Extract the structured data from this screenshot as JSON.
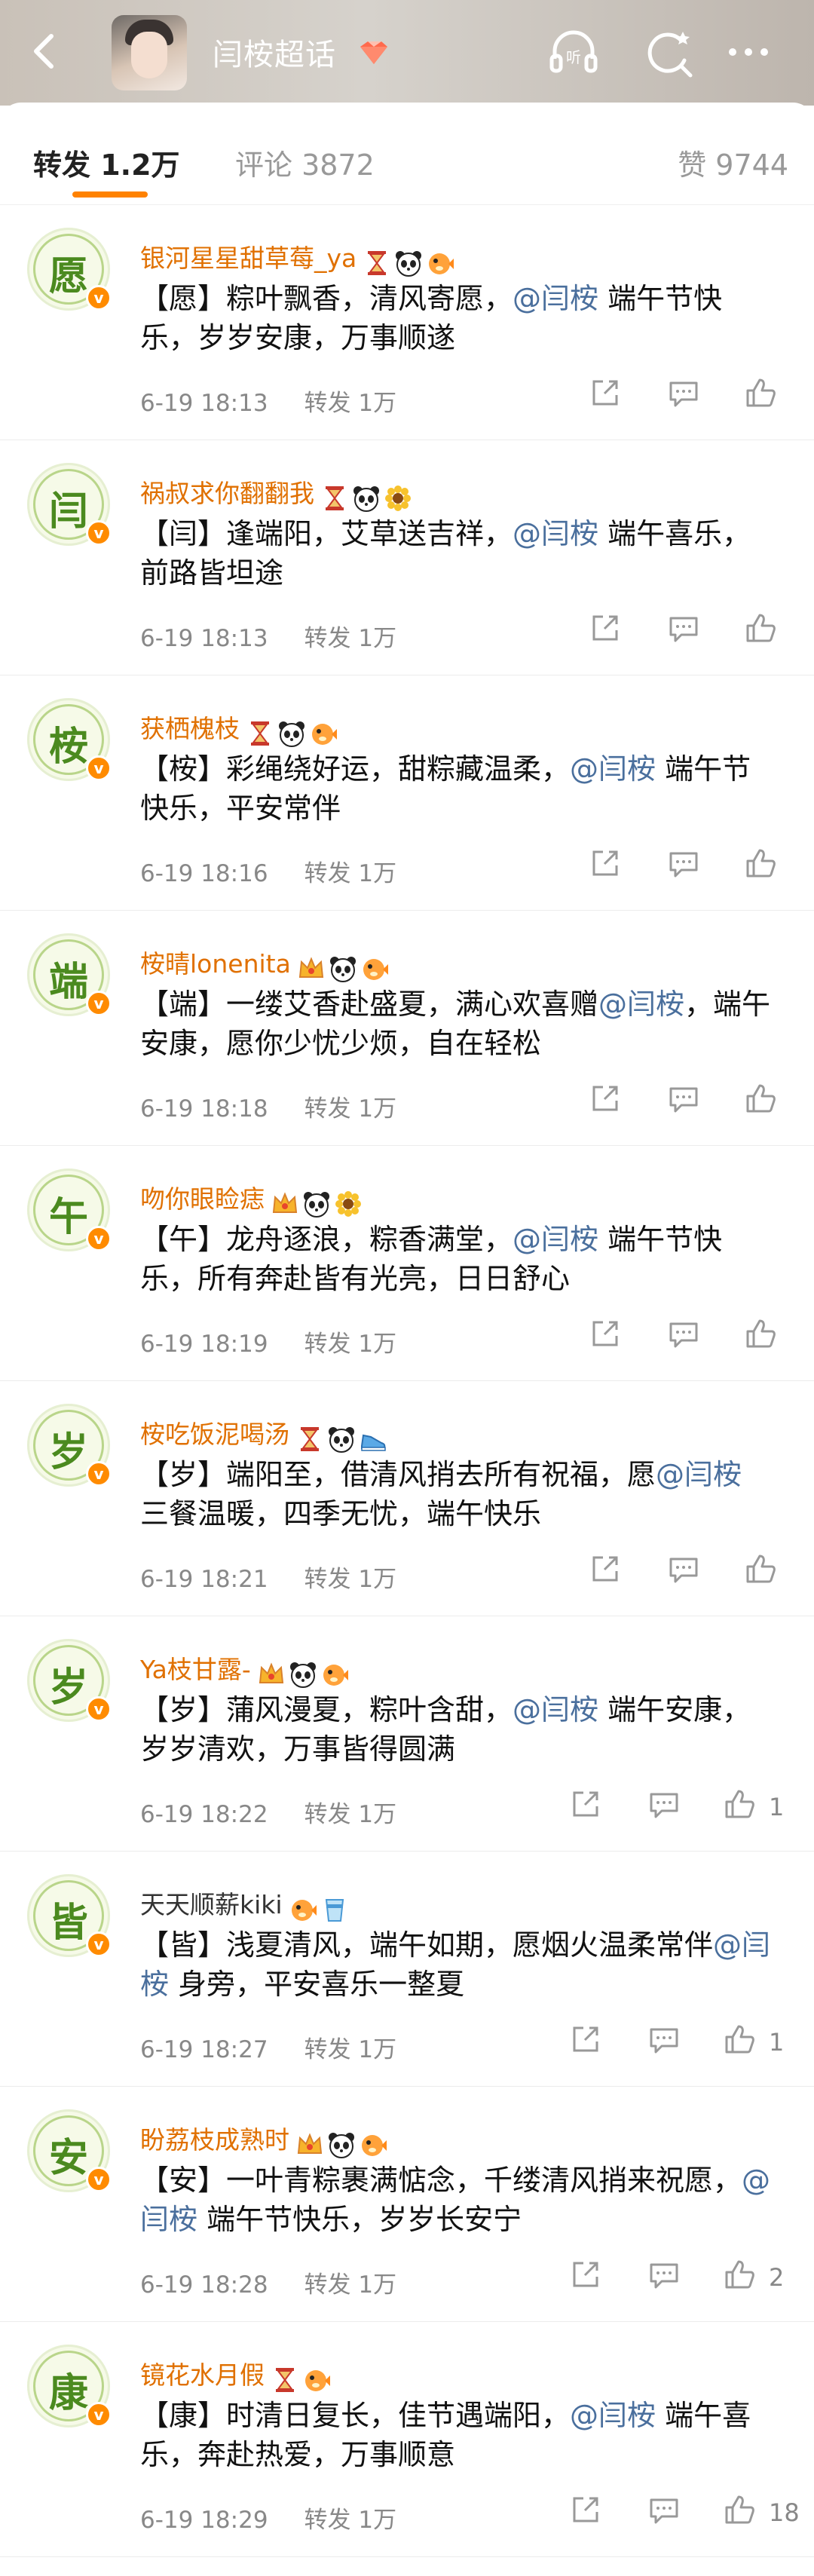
{
  "header": {
    "title": "闫桉超话",
    "back_icon": "chevron-left-icon",
    "listen_label": "听",
    "colors": {
      "brand": "#ff8200",
      "username": "#e07000",
      "mention": "#4a6f9d",
      "meta": "#888888"
    }
  },
  "tabs": {
    "repost": "转发 1.2万",
    "comment": "评论 3872",
    "like": "赞 9744"
  },
  "posts": [
    {
      "avatar_char": "愿",
      "username": "银河星星甜草莓_ya",
      "badges": [
        "hourglass-icon",
        "panda-icon",
        "puffer-fish-icon"
      ],
      "text_a": "【愿】粽叶飘香，清风寄愿，",
      "mention": "@闫桉",
      "text_b": " 端午节快乐，岁岁安康，万事顺遂",
      "time": "6-19 18:13",
      "forward": "转发 1万",
      "likes": ""
    },
    {
      "avatar_char": "闫",
      "username": "祸叔求你翻翻我",
      "badges": [
        "hourglass-icon",
        "panda-icon",
        "sunflower-icon"
      ],
      "text_a": "【闫】逢端阳，艾草送吉祥，",
      "mention": "@闫桉",
      "text_b": " 端午喜乐，前路皆坦途",
      "time": "6-19 18:13",
      "forward": "转发 1万",
      "likes": ""
    },
    {
      "avatar_char": "桉",
      "username": "获栖槐枝",
      "badges": [
        "hourglass-icon",
        "panda-icon",
        "puffer-fish-icon"
      ],
      "text_a": "【桉】彩绳绕好运，甜粽藏温柔，",
      "mention": "@闫桉",
      "text_b": " 端午节快乐，平安常伴",
      "time": "6-19 18:16",
      "forward": "转发 1万",
      "likes": ""
    },
    {
      "avatar_char": "端",
      "username": "桉晴lonenita",
      "badges": [
        "crown-icon",
        "panda-icon",
        "puffer-fish-icon"
      ],
      "text_a": "【端】一缕艾香赴盛夏，满心欢喜赠",
      "mention": "@闫桉",
      "text_b": "，端午安康，愿你少忧少烦，自在轻松",
      "time": "6-19 18:18",
      "forward": "转发 1万",
      "likes": ""
    },
    {
      "avatar_char": "午",
      "username": "吻你眼睑痣",
      "badges": [
        "crown-icon",
        "panda-icon",
        "sunflower-icon"
      ],
      "text_a": "【午】龙舟逐浪，粽香满堂，",
      "mention": "@闫桉",
      "text_b": " 端午节快乐，所有奔赴皆有光亮，日日舒心",
      "time": "6-19 18:19",
      "forward": "转发 1万",
      "likes": ""
    },
    {
      "avatar_char": "岁",
      "username": "桉吃饭泥喝汤",
      "badges": [
        "hourglass-icon",
        "panda-icon",
        "sneaker-icon"
      ],
      "text_a": "【岁】端阳至，借清风捎去所有祝福，愿",
      "mention": "@闫桉",
      "text_b": " 三餐温暖，四季无忧，端午快乐",
      "time": "6-19 18:21",
      "forward": "转发 1万",
      "likes": ""
    },
    {
      "avatar_char": "岁",
      "username": "Ya枝甘露-",
      "badges": [
        "crown-icon",
        "panda-icon",
        "puffer-fish-icon"
      ],
      "text_a": "【岁】蒲风漫夏，粽叶含甜，",
      "mention": "@闫桉",
      "text_b": " 端午安康，岁岁清欢，万事皆得圆满",
      "time": "6-19 18:22",
      "forward": "转发 1万",
      "likes": "1"
    },
    {
      "avatar_char": "皆",
      "username": "天天顺薪kiki",
      "badges": [
        "puffer-fish-icon",
        "cup-icon"
      ],
      "text_a": "【皆】浅夏清风，端午如期，愿烟火温柔常伴",
      "mention": "@闫桉",
      "text_b": " 身旁，平安喜乐一整夏",
      "time": "6-19 18:27",
      "forward": "转发 1万",
      "likes": "1"
    },
    {
      "avatar_char": "安",
      "username": "盼荔枝成熟时",
      "badges": [
        "crown-icon",
        "panda-icon",
        "puffer-fish-icon"
      ],
      "text_a": "【安】一叶青粽裹满惦念，千缕清风捎来祝愿，",
      "mention": "@闫桉",
      "text_b": " 端午节快乐，岁岁长安宁",
      "time": "6-19 18:28",
      "forward": "转发 1万",
      "likes": "2"
    },
    {
      "avatar_char": "康",
      "username": "镜花水月假",
      "badges": [
        "hourglass-icon",
        "puffer-fish-icon"
      ],
      "text_a": "【康】时清日复长，佳节遇端阳，",
      "mention": "@闫桉",
      "text_b": " 端午喜乐，奔赴热爱，万事顺意",
      "time": "6-19 18:29",
      "forward": "转发 1万",
      "likes": "18"
    }
  ]
}
